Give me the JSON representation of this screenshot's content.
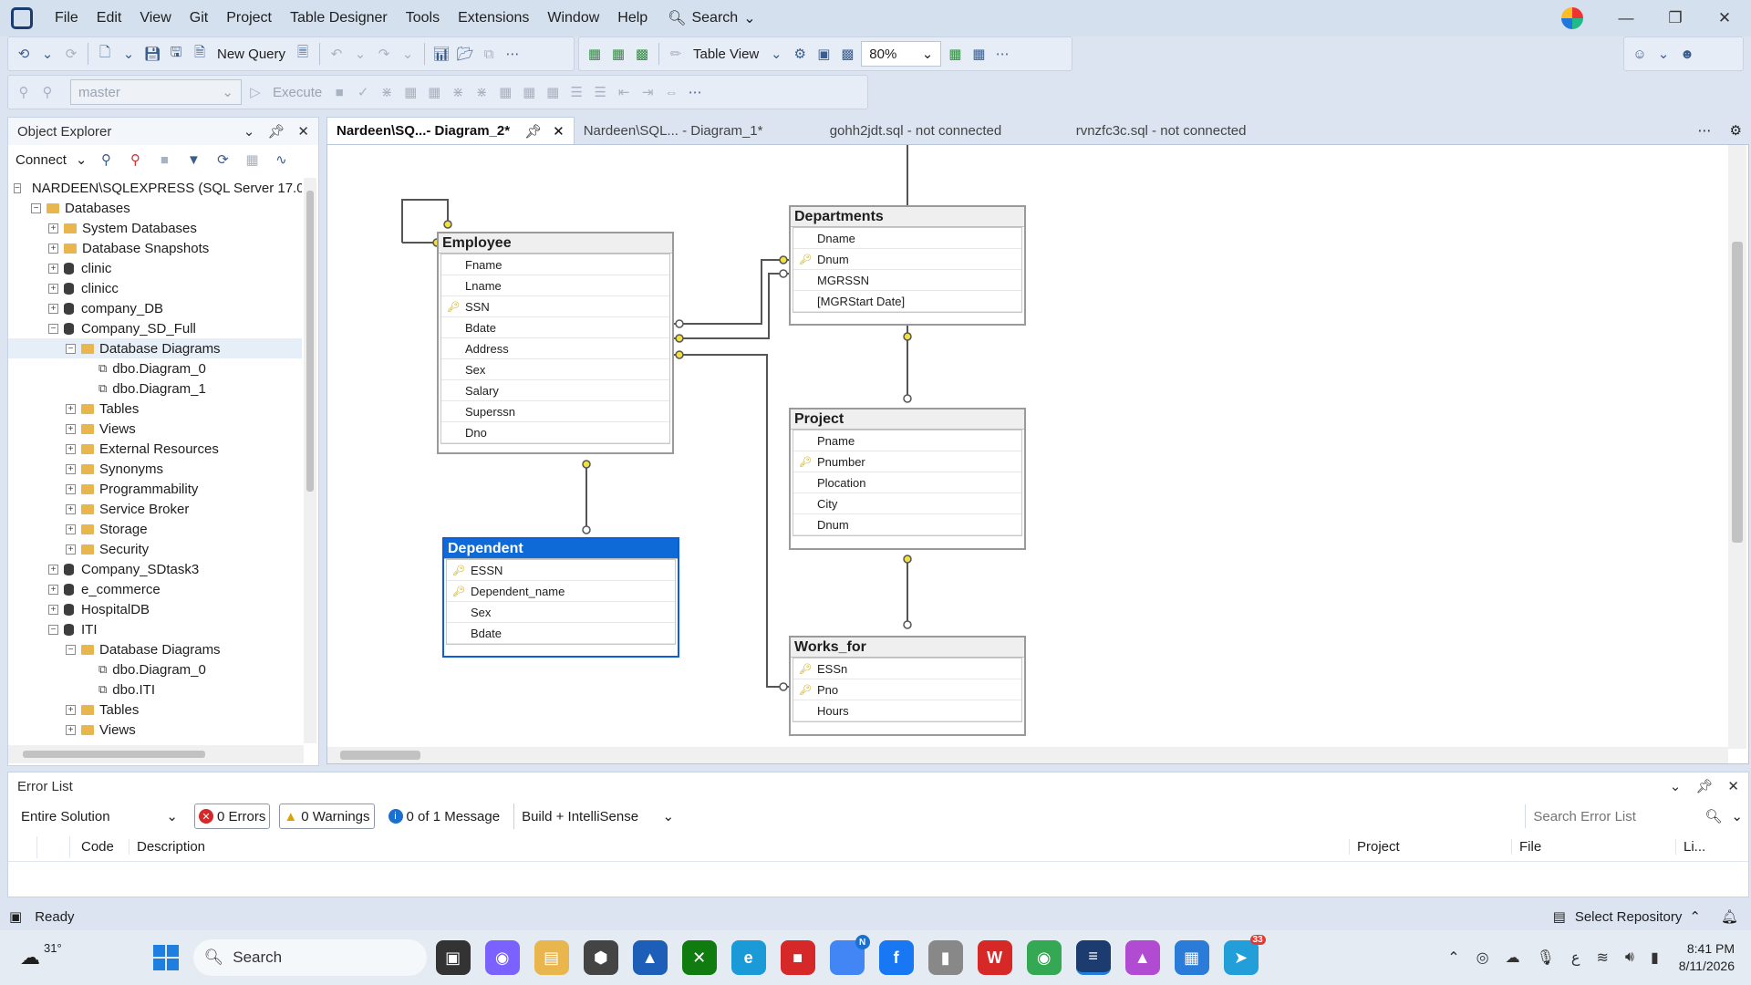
{
  "menu": {
    "items": [
      "File",
      "Edit",
      "View",
      "Git",
      "Project",
      "Table Designer",
      "Tools",
      "Extensions",
      "Window",
      "Help"
    ],
    "search_label": "Search"
  },
  "toolbar": {
    "new_query": "New Query",
    "table_view": "Table View",
    "zoom": "80%",
    "database": "master",
    "execute": "Execute"
  },
  "object_explorer": {
    "title": "Object Explorer",
    "connect": "Connect",
    "tree": [
      {
        "label": "NARDEEN\\SQLEXPRESS (SQL Server 17.0.'",
        "level": 0,
        "icon": "server",
        "exp": "-"
      },
      {
        "label": "Databases",
        "level": 1,
        "icon": "folder",
        "exp": "-"
      },
      {
        "label": "System Databases",
        "level": 2,
        "icon": "folder",
        "exp": "+"
      },
      {
        "label": "Database Snapshots",
        "level": 2,
        "icon": "folder",
        "exp": "+"
      },
      {
        "label": "clinic",
        "level": 2,
        "icon": "db",
        "exp": "+"
      },
      {
        "label": "clinicc",
        "level": 2,
        "icon": "db",
        "exp": "+"
      },
      {
        "label": "company_DB",
        "level": 2,
        "icon": "db",
        "exp": "+"
      },
      {
        "label": "Company_SD_Full",
        "level": 2,
        "icon": "db",
        "exp": "-"
      },
      {
        "label": "Database Diagrams",
        "level": 3,
        "icon": "folder",
        "exp": "-"
      },
      {
        "label": "dbo.Diagram_0",
        "level": 4,
        "icon": "diagram",
        "exp": ""
      },
      {
        "label": "dbo.Diagram_1",
        "level": 4,
        "icon": "diagram",
        "exp": ""
      },
      {
        "label": "Tables",
        "level": 3,
        "icon": "folder",
        "exp": "+"
      },
      {
        "label": "Views",
        "level": 3,
        "icon": "folder",
        "exp": "+"
      },
      {
        "label": "External Resources",
        "level": 3,
        "icon": "folder",
        "exp": "+"
      },
      {
        "label": "Synonyms",
        "level": 3,
        "icon": "folder",
        "exp": "+"
      },
      {
        "label": "Programmability",
        "level": 3,
        "icon": "folder",
        "exp": "+"
      },
      {
        "label": "Service Broker",
        "level": 3,
        "icon": "folder",
        "exp": "+"
      },
      {
        "label": "Storage",
        "level": 3,
        "icon": "folder",
        "exp": "+"
      },
      {
        "label": "Security",
        "level": 3,
        "icon": "folder",
        "exp": "+"
      },
      {
        "label": "Company_SDtask3",
        "level": 2,
        "icon": "db",
        "exp": "+"
      },
      {
        "label": "e_commerce",
        "level": 2,
        "icon": "db",
        "exp": "+"
      },
      {
        "label": "HospitalDB",
        "level": 2,
        "icon": "db",
        "exp": "+"
      },
      {
        "label": "ITI",
        "level": 2,
        "icon": "db",
        "exp": "-"
      },
      {
        "label": "Database Diagrams",
        "level": 3,
        "icon": "folder",
        "exp": "-"
      },
      {
        "label": "dbo.Diagram_0",
        "level": 4,
        "icon": "diagram",
        "exp": ""
      },
      {
        "label": "dbo.ITI",
        "level": 4,
        "icon": "diagram",
        "exp": ""
      },
      {
        "label": "Tables",
        "level": 3,
        "icon": "folder",
        "exp": "+"
      },
      {
        "label": "Views",
        "level": 3,
        "icon": "folder",
        "exp": "+"
      }
    ]
  },
  "tabs": [
    {
      "label": "Nardeen\\SQ...- Diagram_2*",
      "active": true
    },
    {
      "label": "Nardeen\\SQL... - Diagram_1*",
      "active": false
    },
    {
      "label": "gohh2jdt.sql - not connected",
      "active": false
    },
    {
      "label": "rvnzfc3c.sql - not connected",
      "active": false
    }
  ],
  "diagram": {
    "tables": {
      "employee": {
        "name": "Employee",
        "cols": [
          {
            "n": "Fname",
            "k": false
          },
          {
            "n": "Lname",
            "k": false
          },
          {
            "n": "SSN",
            "k": true
          },
          {
            "n": "Bdate",
            "k": false
          },
          {
            "n": "Address",
            "k": false
          },
          {
            "n": "Sex",
            "k": false
          },
          {
            "n": "Salary",
            "k": false
          },
          {
            "n": "Superssn",
            "k": false
          },
          {
            "n": "Dno",
            "k": false
          }
        ]
      },
      "departments": {
        "name": "Departments",
        "cols": [
          {
            "n": "Dname",
            "k": false
          },
          {
            "n": "Dnum",
            "k": true
          },
          {
            "n": "MGRSSN",
            "k": false
          },
          {
            "n": "[MGRStart Date]",
            "k": false
          }
        ]
      },
      "project": {
        "name": "Project",
        "cols": [
          {
            "n": "Pname",
            "k": false
          },
          {
            "n": "Pnumber",
            "k": true
          },
          {
            "n": "Plocation",
            "k": false
          },
          {
            "n": "City",
            "k": false
          },
          {
            "n": "Dnum",
            "k": false
          }
        ]
      },
      "dependent": {
        "name": "Dependent",
        "cols": [
          {
            "n": "ESSN",
            "k": true
          },
          {
            "n": "Dependent_name",
            "k": true
          },
          {
            "n": "Sex",
            "k": false
          },
          {
            "n": "Bdate",
            "k": false
          }
        ]
      },
      "works_for": {
        "name": "Works_for",
        "cols": [
          {
            "n": "ESSn",
            "k": true
          },
          {
            "n": "Pno",
            "k": true
          },
          {
            "n": "Hours",
            "k": false
          }
        ]
      }
    }
  },
  "error_list": {
    "title": "Error List",
    "scope": "Entire Solution",
    "errors": "0 Errors",
    "warnings": "0 Warnings",
    "messages": "0 of 1 Message",
    "build": "Build + IntelliSense",
    "search_placeholder": "Search Error List",
    "columns": {
      "code": "Code",
      "description": "Description",
      "project": "Project",
      "file": "File",
      "line": "Li..."
    }
  },
  "status": {
    "text": "Ready",
    "repo": "Select Repository"
  },
  "taskbar": {
    "weather": "31°",
    "search": "Search",
    "time": "8:41 PM",
    "date": "8/11/2026",
    "badge_edge": "N",
    "badge_telegram": "33"
  },
  "colors": {
    "accent": "#0e6ad6",
    "key": "#c7a000",
    "relationship": "#f0e040"
  }
}
